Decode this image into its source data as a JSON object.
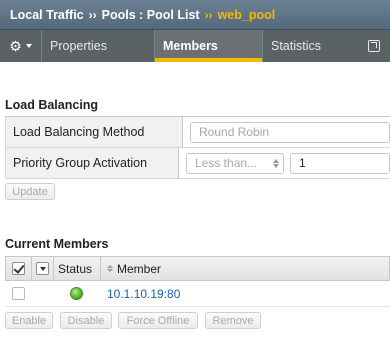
{
  "breadcrumb": {
    "section": "Local Traffic",
    "separator": "››",
    "path": "Pools : Pool List",
    "current": "web_pool"
  },
  "tabs": [
    {
      "label": "Properties"
    },
    {
      "label": "Members",
      "selected": true
    },
    {
      "label": "Statistics"
    }
  ],
  "icons": {
    "gear": "gear-icon",
    "external": "external-link-icon"
  },
  "load_balancing": {
    "title": "Load Balancing",
    "method_label": "Load Balancing Method",
    "method_value": "Round Robin",
    "priority_label": "Priority Group Activation",
    "priority_select": "Less than...",
    "priority_number": "1",
    "update_button": "Update"
  },
  "current_members": {
    "title": "Current Members",
    "columns": {
      "status": "Status",
      "member": "Member"
    },
    "rows": [
      {
        "status": "green",
        "member": "10.1.10.19:80"
      }
    ],
    "buttons": {
      "enable": "Enable",
      "disable": "Disable",
      "force_offline": "Force Offline",
      "remove": "Remove"
    }
  },
  "colors": {
    "accent": "#f5b800",
    "link": "#1a5fb4",
    "header_bg": "#5b6266"
  }
}
